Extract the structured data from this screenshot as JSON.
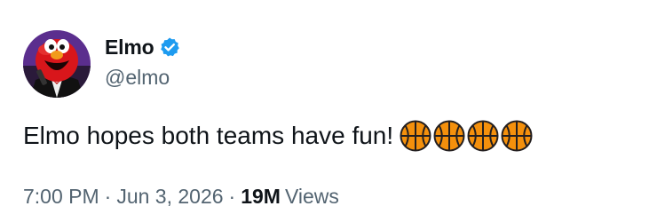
{
  "author": {
    "display_name": "Elmo",
    "handle": "@elmo",
    "verified": true,
    "verified_color": "#1d9bf0",
    "avatar_icon": "elmo-avatar"
  },
  "tweet": {
    "text": "Elmo hopes both teams have fun!",
    "emojis": [
      "basketball-icon",
      "basketball-icon",
      "basketball-icon",
      "basketball-icon"
    ]
  },
  "meta": {
    "time": "7:00 PM",
    "separator": "·",
    "date": "Jun 3, 2026",
    "views_count": "19M",
    "views_label": "Views"
  },
  "colors": {
    "text_primary": "#0f1419",
    "text_secondary": "#536471",
    "accent": "#1d9bf0",
    "basketball": "#f4900c"
  }
}
